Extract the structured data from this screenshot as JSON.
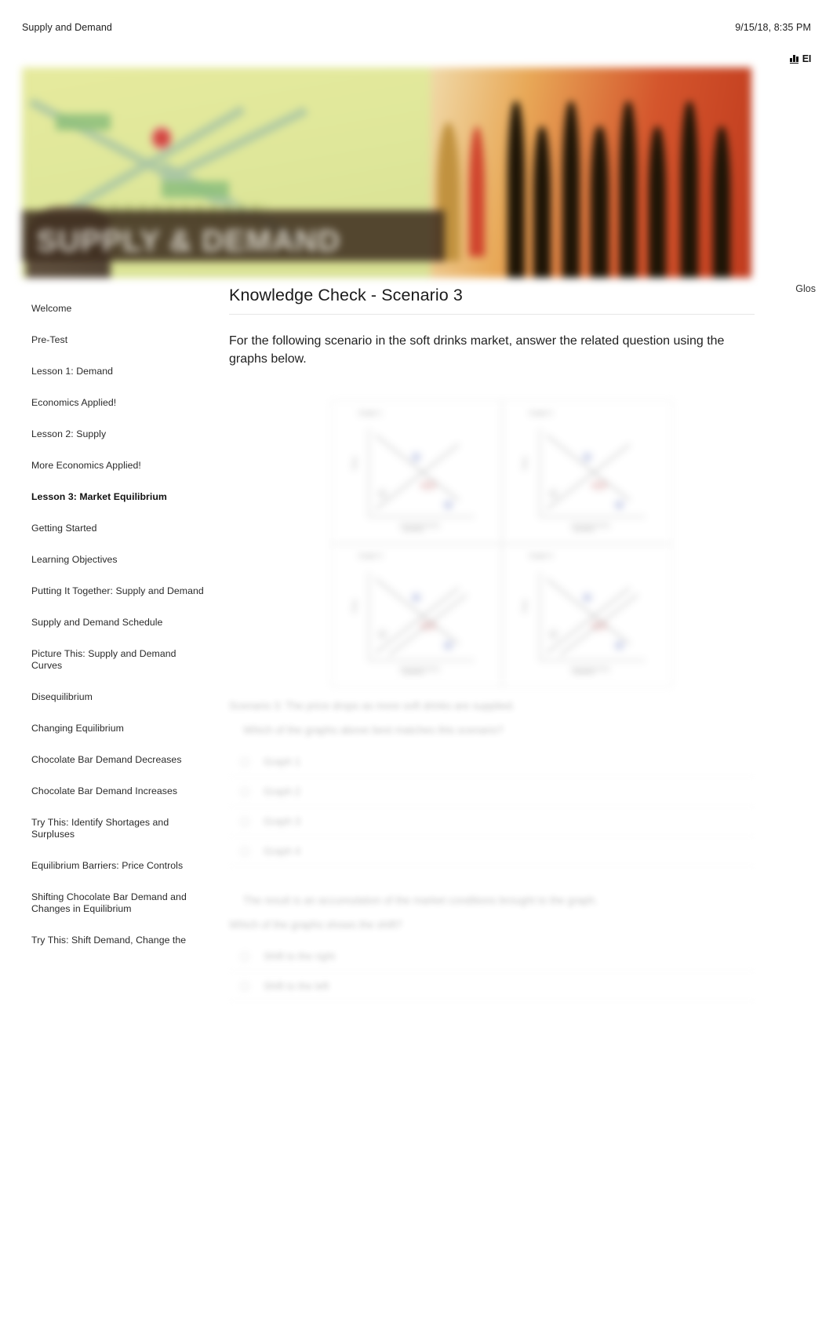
{
  "document": {
    "title": "Supply and Demand",
    "timestamp": "9/15/18, 8:35 PM"
  },
  "toolbar": {
    "chart_icon": "bar-chart-icon",
    "label": "EI"
  },
  "banner": {
    "title": "SUPPLY & DEMAND",
    "colors": {
      "left": "#dfe79a",
      "right": "#d4552c",
      "strip": "#3c2c1e",
      "accent_red": "#c8322a",
      "accent_green": "#8fc07d"
    }
  },
  "glossary": {
    "label": "Glos"
  },
  "sidebar": {
    "items": [
      {
        "label": "Welcome",
        "active": false
      },
      {
        "label": "Pre-Test",
        "active": false
      },
      {
        "label": "Lesson 1: Demand",
        "active": false
      },
      {
        "label": "Economics Applied!",
        "active": false
      },
      {
        "label": "Lesson 2: Supply",
        "active": false
      },
      {
        "label": "More Economics Applied!",
        "active": false
      },
      {
        "label": "Lesson 3: Market Equilibrium",
        "active": true
      },
      {
        "label": "Getting Started",
        "active": false
      },
      {
        "label": "Learning Objectives",
        "active": false
      },
      {
        "label": "Putting It Together: Supply and Demand",
        "active": false
      },
      {
        "label": "Supply and Demand Schedule",
        "active": false
      },
      {
        "label": "Picture This: Supply and Demand Curves",
        "active": false
      },
      {
        "label": "Disequilibrium",
        "active": false
      },
      {
        "label": "Changing Equilibrium",
        "active": false
      },
      {
        "label": "Chocolate Bar Demand Decreases",
        "active": false
      },
      {
        "label": "Chocolate Bar Demand Increases",
        "active": false
      },
      {
        "label": "Try This: Identify Shortages and Surpluses",
        "active": false
      },
      {
        "label": "Equilibrium Barriers: Price Controls",
        "active": false
      },
      {
        "label": "Shifting Chocolate Bar Demand and Changes in Equilibrium",
        "active": false
      },
      {
        "label": "Try This: Shift Demand, Change the",
        "active": false
      }
    ]
  },
  "main": {
    "heading": "Knowledge Check - Scenario 3",
    "intro": "For the following scenario in the soft drinks market, answer the related question using the graphs below.",
    "graphs": [
      {
        "title": "Graph 1",
        "ylabel": "Price",
        "xlabel": "Quantity"
      },
      {
        "title": "Graph 2",
        "ylabel": "Price",
        "xlabel": "Quantity"
      },
      {
        "title": "Graph 3",
        "ylabel": "Price",
        "xlabel": "Quantity"
      },
      {
        "title": "Graph 4",
        "ylabel": "Price",
        "xlabel": "Quantity"
      }
    ]
  },
  "quiz": {
    "scenario_line": "Scenario 3: The price drops as more soft drinks are supplied.",
    "question_1": "Which of the graphs above best matches this scenario?",
    "options_1": [
      {
        "label": "Graph 1",
        "selected": false
      },
      {
        "label": "Graph 2",
        "selected": false
      },
      {
        "label": "Graph 3",
        "selected": false
      },
      {
        "label": "Graph 4",
        "selected": false
      }
    ],
    "followup_text": "The result is an accumulation of the market conditions brought to the graph.",
    "question_2": "Which of the graphs shows the shift?",
    "options_2": [
      {
        "label": "Shift to the right",
        "selected": false
      },
      {
        "label": "Shift to the left",
        "selected": false
      }
    ]
  }
}
